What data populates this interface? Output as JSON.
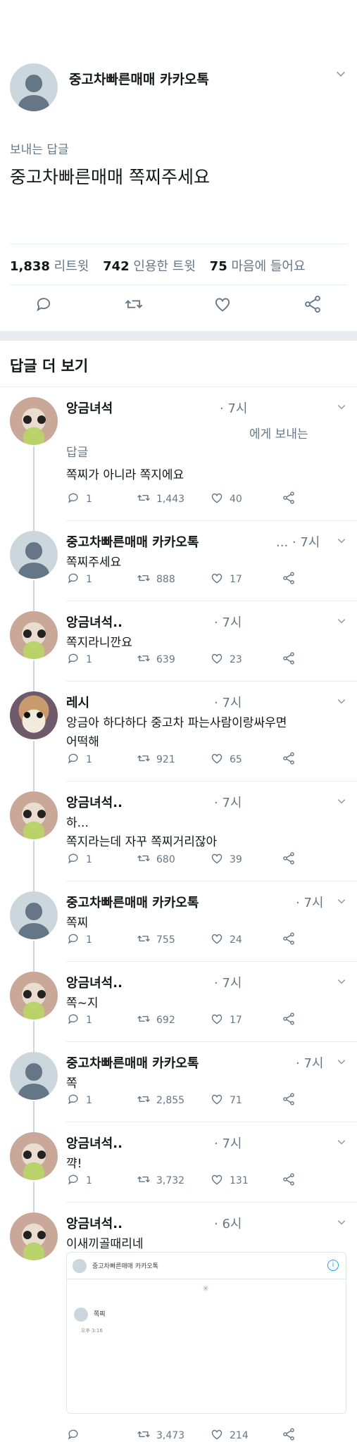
{
  "main": {
    "name": "중고차빠른매매 카카오톡",
    "replying": "보내는 답글",
    "text": "중고차빠른매매 쪽찌주세요",
    "stats": {
      "retweets_count": "1,838",
      "retweets_label": "리트윗",
      "quotes_count": "742",
      "quotes_label": "인용한 트윗",
      "likes_count": "75",
      "likes_label": "마음에 들어요"
    }
  },
  "more_replies_label": "답글 더 보기",
  "replies": [
    {
      "name": "앙금녀석",
      "time": "· 7시",
      "text1": "에게 보내는",
      "text2": "답글",
      "text3": "쪽찌가 아니라 쪽지에요",
      "replies": "1",
      "retweets": "1,443",
      "likes": "40"
    },
    {
      "name": "중고차빠른매매 카카오톡",
      "time": "... · 7시",
      "text1": "쪽찌주세요",
      "replies": "1",
      "retweets": "888",
      "likes": "17"
    },
    {
      "name": "앙금녀석..",
      "time": "· 7시",
      "text1": "쪽지라니깐요",
      "replies": "1",
      "retweets": "639",
      "likes": "23"
    },
    {
      "name": "레시",
      "time": "· 7시",
      "text1": "앙금아 하다하다 중고차 파는사람이랑싸우면",
      "text2": "어떡해",
      "replies": "1",
      "retweets": "921",
      "likes": "65"
    },
    {
      "name": "앙금녀석..",
      "time": "· 7시",
      "text1": "하...",
      "text2": "쪽지라는데 자꾸 쪽찌거리잖아",
      "replies": "1",
      "retweets": "680",
      "likes": "39"
    },
    {
      "name": "중고차빠른매매 카카오톡",
      "time": "· 7시",
      "text1": "쪽찌",
      "replies": "1",
      "retweets": "755",
      "likes": "24"
    },
    {
      "name": "앙금녀석..",
      "time": "· 7시",
      "text1": "쪽~지",
      "replies": "1",
      "retweets": "692",
      "likes": "17"
    },
    {
      "name": "중고차빠른매매 카카오톡",
      "time": "· 7시",
      "text1": "쪽",
      "replies": "1",
      "retweets": "2,855",
      "likes": "71"
    },
    {
      "name": "앙금녀석..",
      "time": "· 7시",
      "text1": "꺅!",
      "replies": "1",
      "retweets": "3,732",
      "likes": "131"
    },
    {
      "name": "앙금녀석..",
      "time": "· 6시",
      "text1": "이새끼골때리네",
      "replies": "",
      "retweets": "3,473",
      "likes": "214"
    }
  ],
  "embedded": {
    "header_title": "중고차빠른매매 카카오톡",
    "info_icon": "i",
    "message": "쪽찌",
    "message_meta": "오후 3:16"
  },
  "icons": {
    "reply": "reply-icon",
    "retweet": "retweet-icon",
    "like": "heart-icon",
    "share": "share-icon",
    "caret": "chevron-down-icon"
  },
  "colors": {
    "text": "#14171a",
    "muted": "#657786",
    "border": "#e6ecf0",
    "default_avatar": "#ccd6dd"
  }
}
